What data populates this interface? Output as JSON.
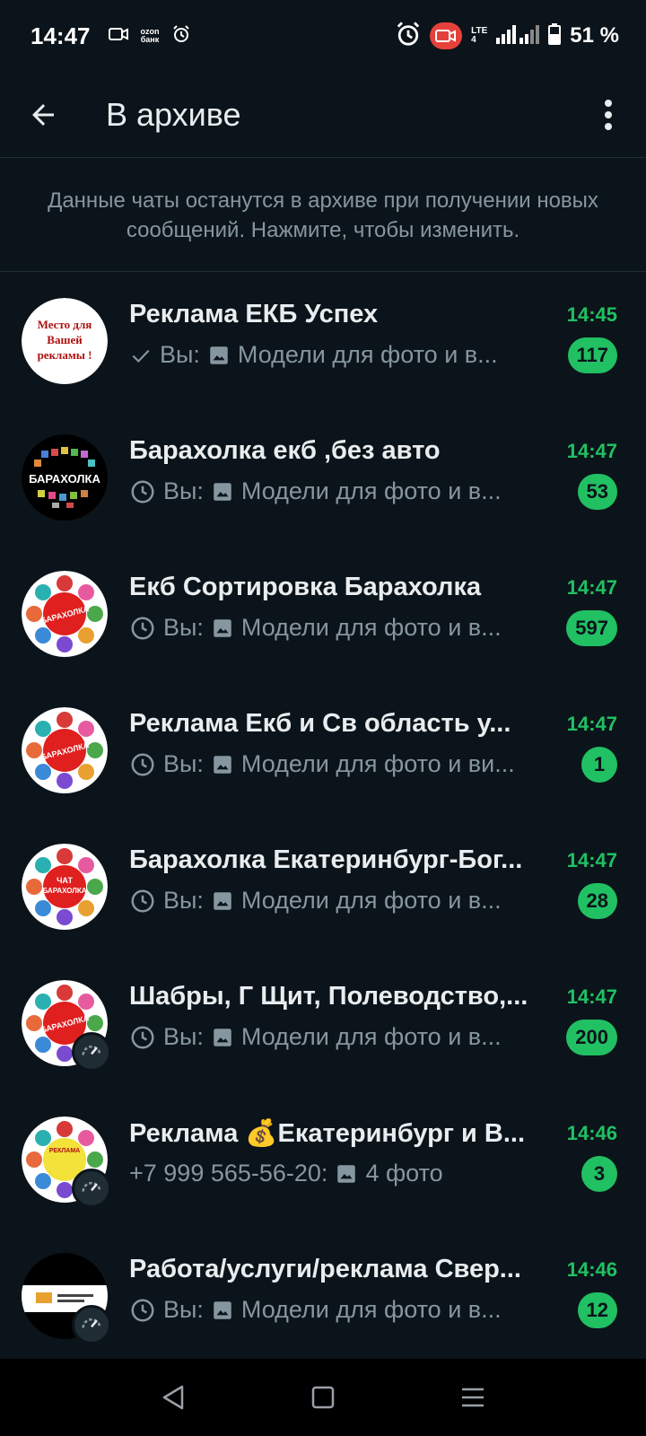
{
  "status_bar": {
    "time": "14:47",
    "ozon_line1": "ozon",
    "ozon_line2": "банк",
    "lte_line1": "LTE",
    "lte_line2": "4",
    "battery": "51 %",
    "icons": [
      "video-camera-icon",
      "ozon-bank-icon",
      "alarm-icon",
      "alarm-icon",
      "screen-record-icon",
      "signal-icon",
      "battery-icon"
    ]
  },
  "app_bar": {
    "title": "В архиве",
    "icons": [
      "back-arrow-icon",
      "more-vert-icon"
    ]
  },
  "archive_info": {
    "text": "Данные чаты останутся в архиве при получении новых сообщений. Нажмите, чтобы изменить."
  },
  "chats": [
    {
      "name": "Реклама ЕКБ Успех",
      "time": "14:45",
      "status_icon": "check-icon",
      "sender": "Вы:",
      "media_icon": "image-icon",
      "preview": "Модели  для фото и в...",
      "unread": "117",
      "avatar_text": [
        "Место для",
        "Вашей",
        "рекламы !"
      ]
    },
    {
      "name": "Барахолка екб ,без авто",
      "time": "14:47",
      "status_icon": "clock-icon",
      "sender": "Вы:",
      "media_icon": "image-icon",
      "preview": "Модели  для фото и в...",
      "unread": "53",
      "avatar_text": [
        "БАРАХОЛКА"
      ]
    },
    {
      "name": "Екб Сортировка Барахолка",
      "time": "14:47",
      "status_icon": "clock-icon",
      "sender": "Вы:",
      "media_icon": "image-icon",
      "preview": "Модели  для фото и в...",
      "unread": "597",
      "avatar_text": [
        "БАРАХОЛКА"
      ]
    },
    {
      "name": "Реклама Екб и Св область у...",
      "time": "14:47",
      "status_icon": "clock-icon",
      "sender": "Вы:",
      "media_icon": "image-icon",
      "preview": "Модели  для фото и ви...",
      "unread": "1",
      "avatar_text": [
        "БАРАХОЛКА"
      ]
    },
    {
      "name": "Барахолка Екатеринбург-Бог...",
      "time": "14:47",
      "status_icon": "clock-icon",
      "sender": "Вы:",
      "media_icon": "image-icon",
      "preview": "Модели  для фото и в...",
      "unread": "28",
      "avatar_text": [
        "ЧАТ",
        "БАРАХОЛКА"
      ]
    },
    {
      "name": "Шабры, Г Щит, Полеводство,...",
      "time": "14:47",
      "status_icon": "clock-icon",
      "sender": "Вы:",
      "media_icon": "image-icon",
      "preview": "Модели  для фото и в...",
      "unread": "200",
      "avatar_text": [
        "БАРАХОЛКА"
      ]
    },
    {
      "name": "Реклама 💰Екатеринбург и В...",
      "time": "14:46",
      "status_icon": "",
      "sender": "+7 999 565-56-20:",
      "media_icon": "image-icon",
      "preview": "4 фото",
      "unread": "3",
      "avatar_text": [
        "РЕКЛАМА"
      ]
    },
    {
      "name": "Работа/услуги/реклама Свер...",
      "time": "14:46",
      "status_icon": "clock-icon",
      "sender": "Вы:",
      "media_icon": "image-icon",
      "preview": "Модели  для фото и в...",
      "unread": "12",
      "avatar_text": []
    }
  ],
  "colors": {
    "background": "#0b141a",
    "accent_green": "#21c063",
    "secondary_text": "#8696a0",
    "primary_text": "#e9edef"
  },
  "nav_bar": {
    "icons": [
      "nav-back-icon",
      "nav-home-icon",
      "nav-recents-icon"
    ]
  }
}
